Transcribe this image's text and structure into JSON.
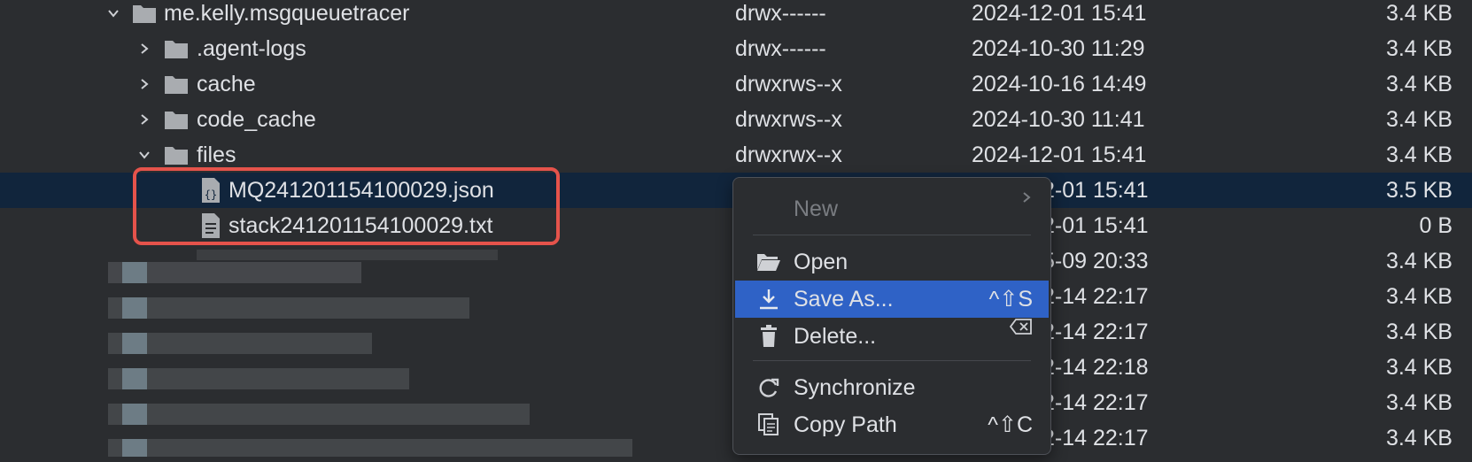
{
  "rows": [
    {
      "name": "me.kelly.msgqueuetracer",
      "perm": "drwx------",
      "date": "2024-12-01 15:41",
      "size": "3.4 KB"
    },
    {
      "name": ".agent-logs",
      "perm": "drwx------",
      "date": "2024-10-30 11:29",
      "size": "3.4 KB"
    },
    {
      "name": "cache",
      "perm": "drwxrws--x",
      "date": "2024-10-16 14:49",
      "size": "3.4 KB"
    },
    {
      "name": "code_cache",
      "perm": "drwxrws--x",
      "date": "2024-10-30 11:41",
      "size": "3.4 KB"
    },
    {
      "name": "files",
      "perm": "drwxrwx--x",
      "date": "2024-12-01 15:41",
      "size": "3.4 KB"
    },
    {
      "name": "MQ241201154100029.json",
      "date": "2-01 15:41",
      "size": "3.5 KB"
    },
    {
      "name": "stack241201154100029.txt",
      "date": "2-01 15:41",
      "size": "0 B"
    },
    {
      "date": "5-09 20:33",
      "size": "3.4 KB"
    },
    {
      "date": "2-14 22:17",
      "size": "3.4 KB"
    },
    {
      "date": "2-14 22:17",
      "size": "3.4 KB"
    },
    {
      "date": "2-14 22:18",
      "size": "3.4 KB"
    },
    {
      "date": "2-14 22:17",
      "size": "3.4 KB"
    },
    {
      "date": "2-14 22:17",
      "size": "3.4 KB"
    }
  ],
  "menu": {
    "new_label": "New",
    "open_label": "Open",
    "save_as_label": "Save As...",
    "save_as_shortcut": "^⇧S",
    "delete_label": "Delete...",
    "sync_label": "Synchronize",
    "copy_path_label": "Copy Path",
    "copy_path_shortcut": "^⇧C"
  },
  "colors": {
    "background": "#2b2d30",
    "selection": "#11253c",
    "menu_active": "#2f62c6",
    "highlight_border": "#e5534b"
  }
}
